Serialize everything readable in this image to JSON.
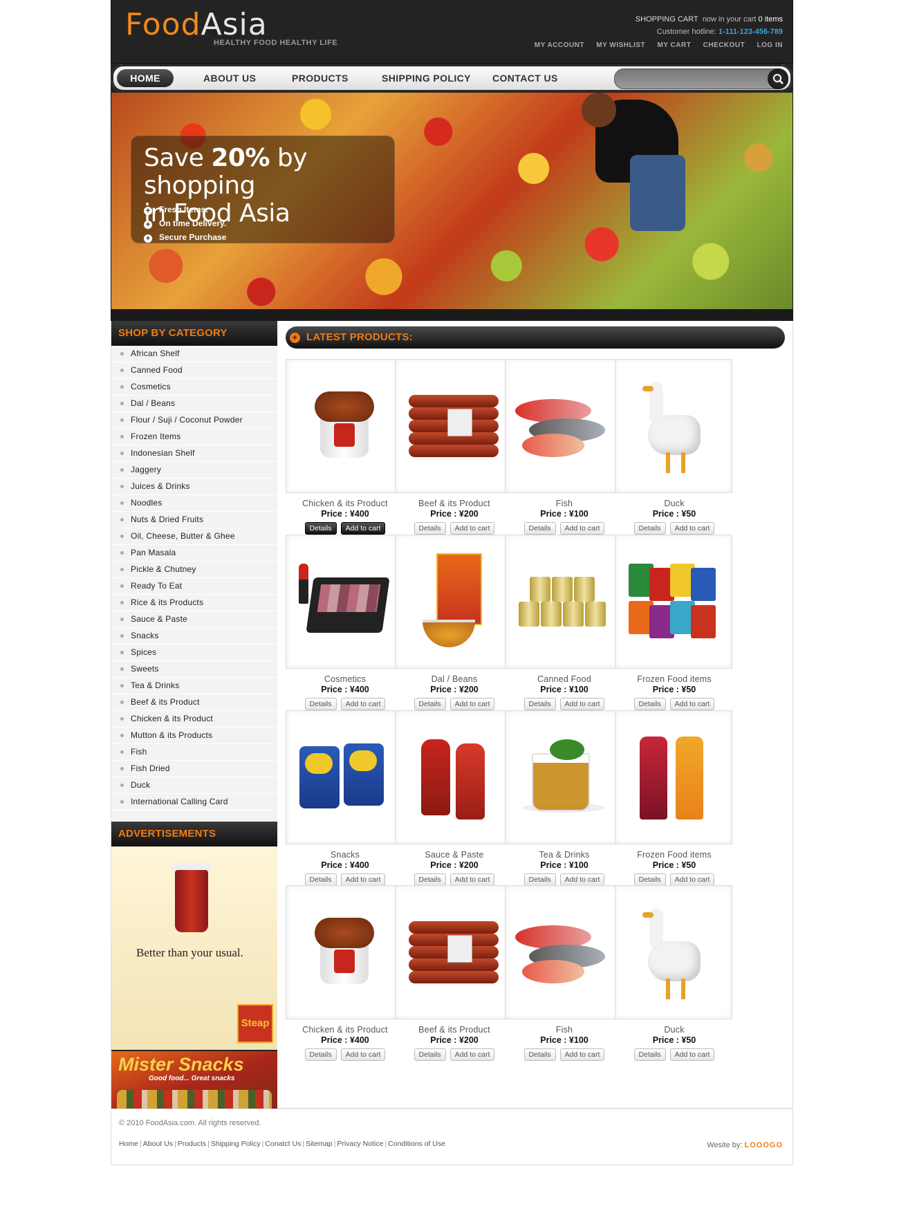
{
  "header": {
    "logo_food": "Food",
    "logo_asia": "Asia",
    "tagline": "HEALTHY FOOD HEALTHY LIFE",
    "cart_label": "SHOPPING CART",
    "cart_text": "now in your cart",
    "cart_count": "0 items",
    "hotline_label": "Customer hotline:",
    "hotline_number": "1-111-123-456-789",
    "top_links": [
      "MY ACCOUNT",
      "MY WISHLIST",
      "MY CART",
      "CHECKOUT",
      "LOG IN"
    ]
  },
  "nav": {
    "items": [
      "HOME",
      "ABOUT US",
      "PRODUCTS",
      "SHIPPING POLICY",
      "CONTACT US"
    ],
    "search_value": ""
  },
  "banner": {
    "line1_pre": "Save ",
    "line1_big": "20%",
    "line1_post": " by shopping",
    "line2": "in Food Asia",
    "bullets": [
      "Fresh Items.",
      "On time Delivery.",
      "Secure Purchase"
    ]
  },
  "sidebar": {
    "category_title": "SHOP BY CATEGORY",
    "categories": [
      "African Shelf",
      "Canned Food",
      "Cosmetics",
      "Dal / Beans",
      "Flour / Suji / Coconut Powder",
      "Frozen Items",
      "Indonesian Shelf",
      "Jaggery",
      "Juices & Drinks",
      "Noodles",
      "Nuts & Dried Fruits",
      "Oil, Cheese, Butter & Ghee",
      "Pan Masala",
      "Pickle & Chutney",
      "Ready To Eat",
      "Rice & its Products",
      "Sauce & Paste",
      "Snacks",
      "Spices",
      "Sweets",
      "Tea & Drinks",
      "Beef & its Product",
      "Chicken & its Product",
      "Mutton & its Products",
      "Fish",
      "Fish Dried",
      "Duck",
      "International Calling Card"
    ],
    "ads_title": "ADVERTISEMENTS",
    "ad1_text": "Better than your usual.",
    "ad1_logo": "Steap",
    "ad2_title": "Mister Snacks",
    "ad2_sub": "Good food... Great snacks"
  },
  "main": {
    "title": "LATEST PRODUCTS:",
    "details_label": "Details",
    "cart_label": "Add to cart",
    "products": [
      {
        "name": "Chicken & its Product",
        "price": "Price : ¥400",
        "icon": "chicken-bucket"
      },
      {
        "name": "Beef & its Product",
        "price": "Price : ¥200",
        "icon": "beef-sausages"
      },
      {
        "name": "Fish",
        "price": "Price : ¥100",
        "icon": "fish"
      },
      {
        "name": "Duck",
        "price": "Price : ¥50",
        "icon": "duck"
      },
      {
        "name": "Cosmetics",
        "price": "Price : ¥400",
        "icon": "makeup-palette"
      },
      {
        "name": "Dal / Beans",
        "price": "Price : ¥200",
        "icon": "dal-box"
      },
      {
        "name": "Canned Food",
        "price": "Price : ¥100",
        "icon": "cans"
      },
      {
        "name": "Frozen Food items",
        "price": "Price : ¥50",
        "icon": "frozen-packs"
      },
      {
        "name": "Snacks",
        "price": "Price : ¥400",
        "icon": "chip-bags"
      },
      {
        "name": "Sauce & Paste",
        "price": "Price : ¥200",
        "icon": "sauce-bottles"
      },
      {
        "name": "Tea & Drinks",
        "price": "Price : ¥100",
        "icon": "tea-glass"
      },
      {
        "name": "Frozen Food items",
        "price": "Price : ¥50",
        "icon": "juice-bottles"
      },
      {
        "name": "Chicken & its Product",
        "price": "Price : ¥400",
        "icon": "chicken-bucket"
      },
      {
        "name": "Beef & its Product",
        "price": "Price : ¥200",
        "icon": "beef-sausages"
      },
      {
        "name": "Fish",
        "price": "Price : ¥100",
        "icon": "fish"
      },
      {
        "name": "Duck",
        "price": "Price : ¥50",
        "icon": "duck"
      }
    ]
  },
  "footer": {
    "copyright": "© 2010 FoodAsia.com. All rights reserved.",
    "links": [
      "Home",
      "About Us",
      "Products",
      "Shipping Policy",
      "Conatct Us",
      "Sitemap",
      "Privacy Notice",
      "Conditions of Use"
    ],
    "credit_label": "Wesite by:",
    "credit_brand": "LOOOGO"
  },
  "colors": {
    "accent": "#f07a12",
    "dark": "#232323",
    "link_blue": "#33a7e0"
  }
}
